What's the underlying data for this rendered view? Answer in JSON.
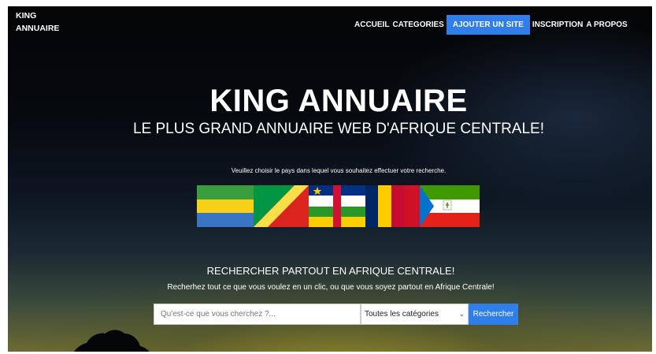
{
  "brand": {
    "line1": "KING",
    "line2": "ANNUAIRE"
  },
  "nav": {
    "items": [
      {
        "label": "ACCUEIL"
      },
      {
        "label": "CATEGORIES"
      },
      {
        "label": "AJOUTER UN SITE"
      },
      {
        "label": "INSCRIPTION"
      },
      {
        "label": "A PROPOS"
      }
    ],
    "active_color": "#2f7ee9"
  },
  "hero": {
    "title": "KING ANNUAIRE",
    "subtitle": "LE PLUS GRAND ANNUAIRE WEB D'AFRIQUE CENTRALE!"
  },
  "country_prompt": "Veuillez choisir le pays dans lequel vous souhaitez effectuer votre recherche.",
  "flags": [
    "gabon-flag",
    "congo-flag",
    "central-african-republic-flag",
    "chad-flag",
    "cameroon-flag",
    "equatorial-guinea-flag"
  ],
  "search": {
    "title": "RECHERCHER PARTOUT EN AFRIQUE CENTRALE!",
    "subtitle": "Recherhez tout ce que vous voulez en un clic, ou que vous soyez partout en Afrique Centrale!",
    "placeholder": "Qu'est-ce que vous cherchez ?...",
    "category_value": "Toutes les catégories",
    "button": "Rechercher"
  },
  "colors": {
    "accent": "#2f7ee9",
    "background": "#05070b"
  }
}
